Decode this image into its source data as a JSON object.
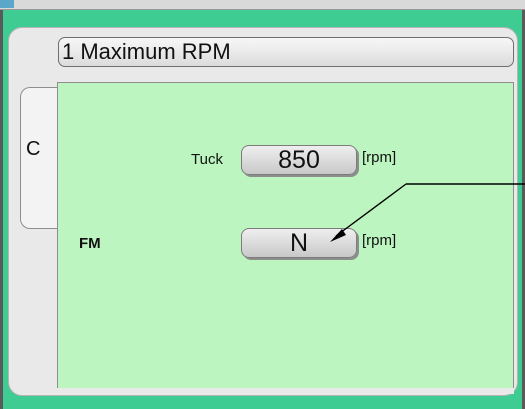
{
  "panel": {
    "title": "1 Maximum RPM",
    "tab_label": "C"
  },
  "tuck": {
    "label": "Tuck",
    "value": "850",
    "unit": "[rpm]"
  },
  "fm": {
    "label": "FM",
    "value": "N",
    "unit": "[rpm]"
  },
  "colors": {
    "background": "#3fcc92",
    "content": "#bcf5c0"
  },
  "icons": [
    "pointer-arrow-icon"
  ]
}
